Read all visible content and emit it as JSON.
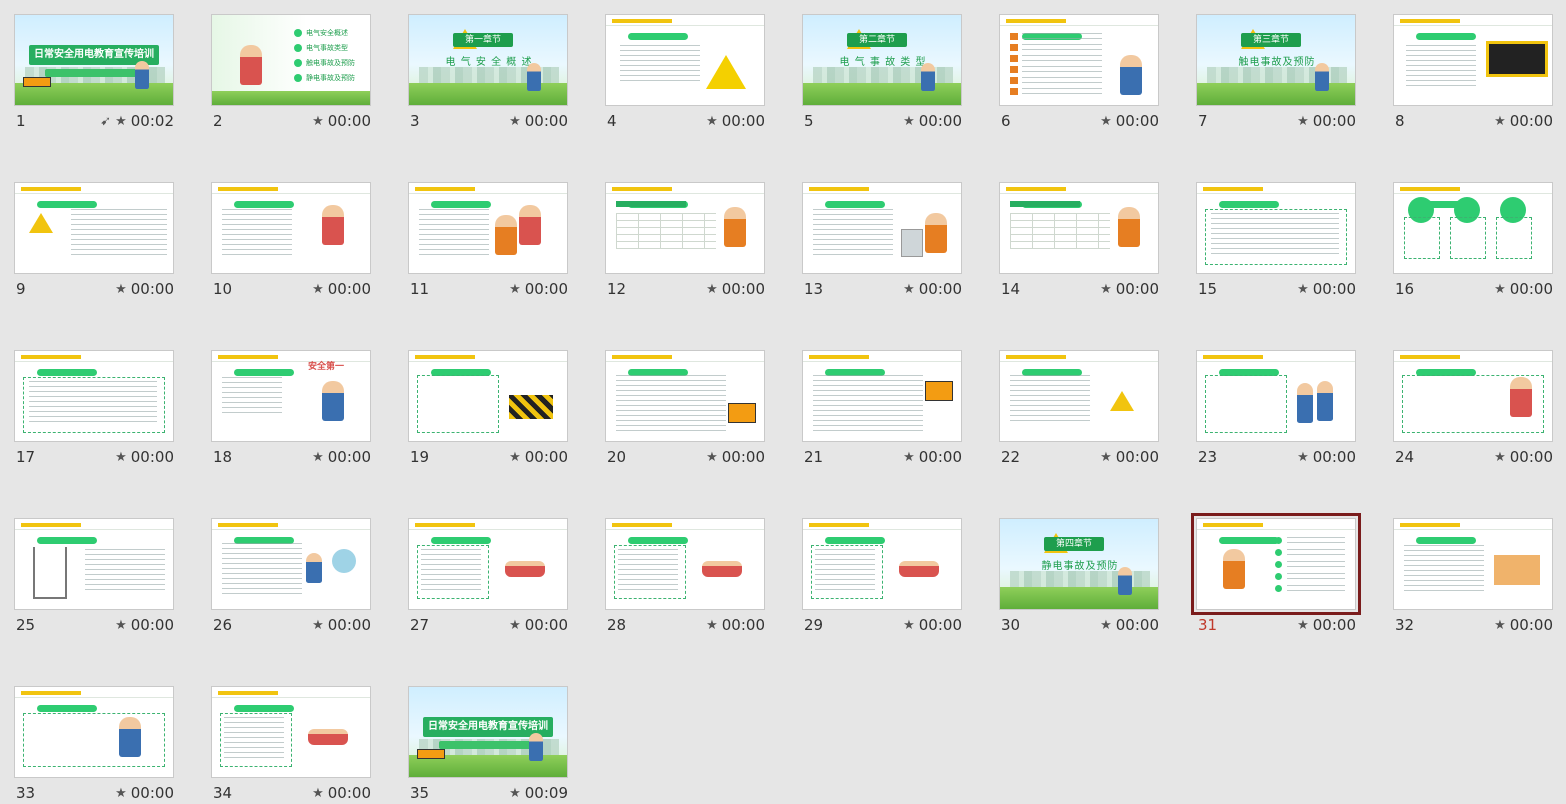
{
  "slides": [
    {
      "num": "1",
      "time": "00:02",
      "kind": "cover",
      "title": "日常安全用电教育宣传培训",
      "transition": true
    },
    {
      "num": "2",
      "time": "00:00",
      "kind": "toc",
      "items": [
        "电气安全概述",
        "电气事故类型",
        "触电事故及预防",
        "静电事故及预防"
      ]
    },
    {
      "num": "3",
      "time": "00:00",
      "kind": "chapter",
      "chapter": "第一章节",
      "subtitle": "电 气 安 全 概 述"
    },
    {
      "num": "4",
      "time": "00:00",
      "kind": "content-warn"
    },
    {
      "num": "5",
      "time": "00:00",
      "kind": "chapter",
      "chapter": "第二章节",
      "subtitle": "电 气 事 故 类 型"
    },
    {
      "num": "6",
      "time": "00:00",
      "kind": "content-list"
    },
    {
      "num": "7",
      "time": "00:00",
      "kind": "chapter",
      "chapter": "第三章节",
      "subtitle": "触电事故及预防"
    },
    {
      "num": "8",
      "time": "00:00",
      "kind": "content-danger"
    },
    {
      "num": "9",
      "time": "00:00",
      "kind": "content-warn-left"
    },
    {
      "num": "10",
      "time": "00:00",
      "kind": "content-person"
    },
    {
      "num": "11",
      "time": "00:00",
      "kind": "content-people"
    },
    {
      "num": "12",
      "time": "00:00",
      "kind": "content-table"
    },
    {
      "num": "13",
      "time": "00:00",
      "kind": "content-worker"
    },
    {
      "num": "14",
      "time": "00:00",
      "kind": "content-table-person"
    },
    {
      "num": "15",
      "time": "00:00",
      "kind": "content-text"
    },
    {
      "num": "16",
      "time": "00:00",
      "kind": "content-circles"
    },
    {
      "num": "17",
      "time": "00:00",
      "kind": "content-text-box"
    },
    {
      "num": "18",
      "time": "00:00",
      "kind": "content-safety",
      "label": "安全第一"
    },
    {
      "num": "19",
      "time": "00:00",
      "kind": "content-barrier"
    },
    {
      "num": "20",
      "time": "00:00",
      "kind": "content-text-sign"
    },
    {
      "num": "21",
      "time": "00:00",
      "kind": "content-text-danger"
    },
    {
      "num": "22",
      "time": "00:00",
      "kind": "content-warn-right"
    },
    {
      "num": "23",
      "time": "00:00",
      "kind": "content-workers"
    },
    {
      "num": "24",
      "time": "00:00",
      "kind": "content-runner"
    },
    {
      "num": "25",
      "time": "00:00",
      "kind": "content-tower"
    },
    {
      "num": "26",
      "time": "00:00",
      "kind": "content-fan"
    },
    {
      "num": "27",
      "time": "00:00",
      "kind": "content-rescue"
    },
    {
      "num": "28",
      "time": "00:00",
      "kind": "content-cpr"
    },
    {
      "num": "29",
      "time": "00:00",
      "kind": "content-fall"
    },
    {
      "num": "30",
      "time": "00:00",
      "kind": "chapter",
      "chapter": "第四章节",
      "subtitle": "静电事故及预防"
    },
    {
      "num": "31",
      "time": "00:00",
      "kind": "content-steps",
      "selected": true
    },
    {
      "num": "32",
      "time": "00:00",
      "kind": "content-factory"
    },
    {
      "num": "33",
      "time": "00:00",
      "kind": "content-meter"
    },
    {
      "num": "34",
      "time": "00:00",
      "kind": "content-shock"
    },
    {
      "num": "35",
      "time": "00:09",
      "kind": "cover",
      "title": "日常安全用电教育宣传培训"
    }
  ],
  "colors": {
    "selected_border": "#7a1c1c",
    "selected_number": "#c0392b",
    "accent": "#27ae60",
    "warning": "#f1c40f"
  },
  "icons": {
    "timing": "star-icon",
    "transition": "flying-bird-icon"
  }
}
